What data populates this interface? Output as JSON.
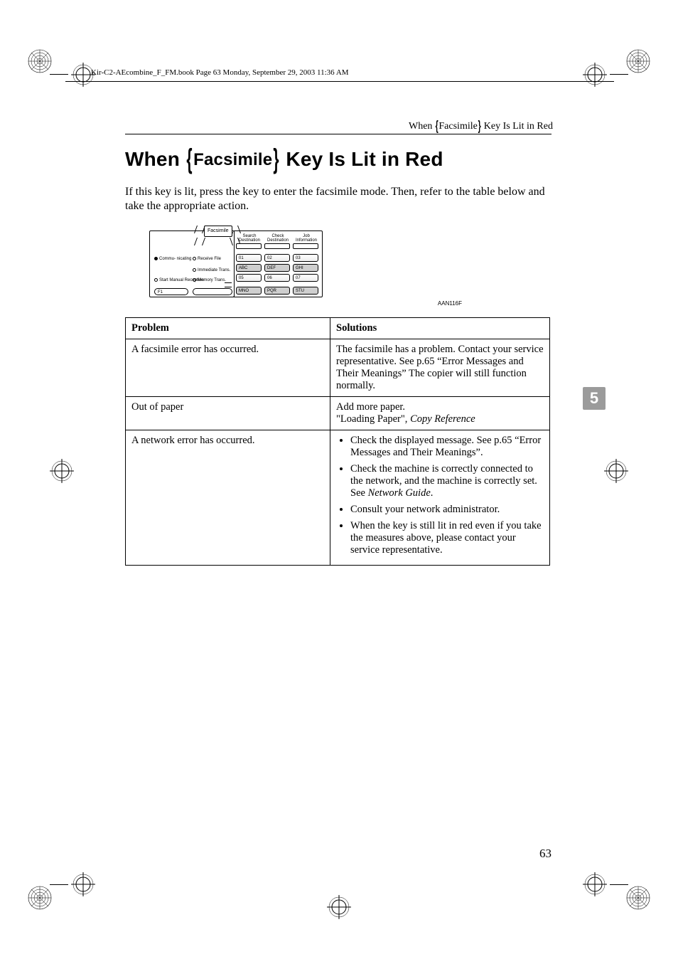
{
  "book_header": "Kir-C2-AEcombine_F_FM.book  Page 63  Monday, September 29, 2003  11:36 AM",
  "running_head": {
    "pre": "When",
    "word": "Facsimile",
    "post": "Key Is Lit in Red"
  },
  "h1": {
    "pre": "When ",
    "word": "Facsimile",
    "post": " Key Is Lit in Red"
  },
  "intro": "If this key is lit, press the key to enter the facsimile mode. Then, refer to the table below and take the appropriate action.",
  "figure": {
    "tab": "Facsimile",
    "left_labels": {
      "communicating": "Commu-\nnicating",
      "receive_file": "Receive File",
      "immediate": "Immediate\nTrans.",
      "start_manual": "Start Manual\nReception",
      "memory": "Memory\nTrans.",
      "f1": "F1"
    },
    "right_headers": {
      "a": "Search\nDestination",
      "b": "Check\nDestination",
      "c": "Job\nInformation"
    },
    "keys": {
      "k01": "01",
      "k02": "02",
      "k03": "03",
      "abc": "ABC",
      "def": "DEF",
      "ghi": "GHI",
      "k05": "05",
      "k06": "06",
      "k07": "07",
      "mno": "MNO",
      "pqr": "PQR",
      "stu": "STU"
    },
    "code": "AAN116F"
  },
  "table": {
    "head": {
      "problem": "Problem",
      "solutions": "Solutions"
    },
    "rows": [
      {
        "problem": "A facsimile error has occurred.",
        "solution_text": "The facsimile has a problem. Contact your service representative. See p.65 “Error Messages and Their Meanings” The copier will still function normally."
      },
      {
        "problem": "Out of paper",
        "solution_text": "Add more paper.",
        "solution_ref_pre": "\"Loading Paper\", ",
        "solution_ref_ital": "Copy Reference"
      },
      {
        "problem": "A network error has occurred.",
        "bullets": [
          {
            "text": "Check the displayed message. See p.65 “Error Messages and Their Meanings”."
          },
          {
            "text_pre": "Check the machine is correctly connected to the network, and the machine is correctly set. See ",
            "ital": "Network Guide",
            "text_post": "."
          },
          {
            "text": "Consult your network administrator."
          },
          {
            "text": "When the key is still lit in red even if you take the measures above, please contact your service representative."
          }
        ]
      }
    ]
  },
  "chapter_tab": "5",
  "page_number": "63"
}
